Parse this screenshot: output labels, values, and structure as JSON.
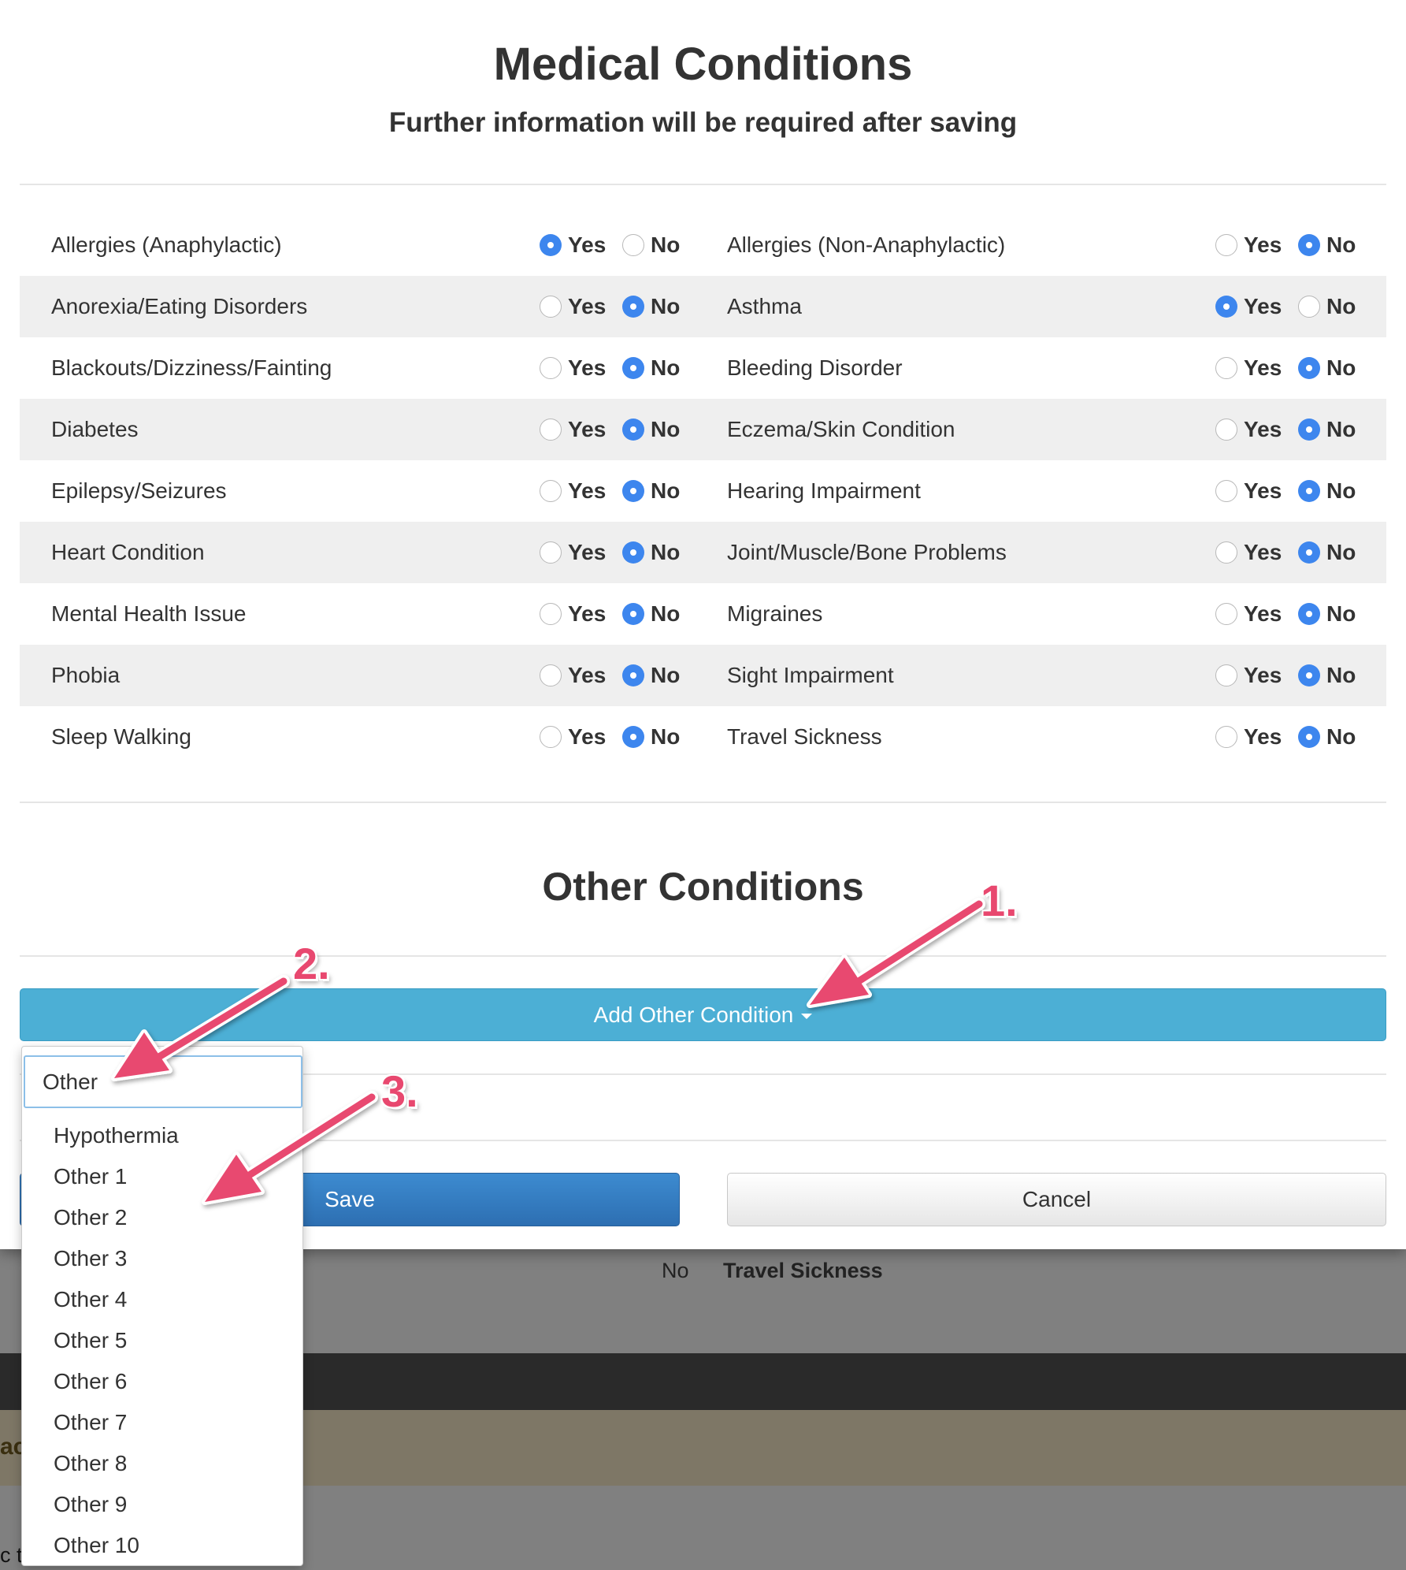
{
  "modal": {
    "title": "Medical Conditions",
    "subtitle": "Further information will be required after saving",
    "yes_label": "Yes",
    "no_label": "No",
    "conditions": [
      {
        "left": {
          "name": "Allergies (Anaphylactic)",
          "value": "yes"
        },
        "right": {
          "name": "Allergies (Non-Anaphylactic)",
          "value": "no"
        }
      },
      {
        "left": {
          "name": "Anorexia/Eating Disorders",
          "value": "no"
        },
        "right": {
          "name": "Asthma",
          "value": "yes"
        }
      },
      {
        "left": {
          "name": "Blackouts/Dizziness/Fainting",
          "value": "no"
        },
        "right": {
          "name": "Bleeding Disorder",
          "value": "no"
        }
      },
      {
        "left": {
          "name": "Diabetes",
          "value": "no"
        },
        "right": {
          "name": "Eczema/Skin Condition",
          "value": "no"
        }
      },
      {
        "left": {
          "name": "Epilepsy/Seizures",
          "value": "no"
        },
        "right": {
          "name": "Hearing Impairment",
          "value": "no"
        }
      },
      {
        "left": {
          "name": "Heart Condition",
          "value": "no"
        },
        "right": {
          "name": "Joint/Muscle/Bone Problems",
          "value": "no"
        }
      },
      {
        "left": {
          "name": "Mental Health Issue",
          "value": "no"
        },
        "right": {
          "name": "Migraines",
          "value": "no"
        }
      },
      {
        "left": {
          "name": "Phobia",
          "value": "no"
        },
        "right": {
          "name": "Sight Impairment",
          "value": "no"
        }
      },
      {
        "left": {
          "name": "Sleep Walking",
          "value": "no"
        },
        "right": {
          "name": "Travel Sickness",
          "value": "no"
        }
      }
    ],
    "other_title": "Other Conditions",
    "add_other_label": "Add Other Condition",
    "save_label": "Save",
    "cancel_label": "Cancel"
  },
  "dropdown": {
    "search_value": "Other",
    "options": [
      "Hypothermia",
      "Other 1",
      "Other 2",
      "Other 3",
      "Other 4",
      "Other 5",
      "Other 6",
      "Other 7",
      "Other 8",
      "Other 9",
      "Other 10"
    ]
  },
  "background": {
    "no_text": "No",
    "travel_text": "Travel Sickness",
    "tan_text": "ac",
    "bottom_text": "c t"
  },
  "annotations": {
    "step1": "1.",
    "step2": "2.",
    "step3": "3.",
    "color": "#e8486f"
  },
  "colors": {
    "accent_blue": "#3d86ee",
    "add_button": "#4cafd5",
    "save_button": "#2d6fb2"
  }
}
